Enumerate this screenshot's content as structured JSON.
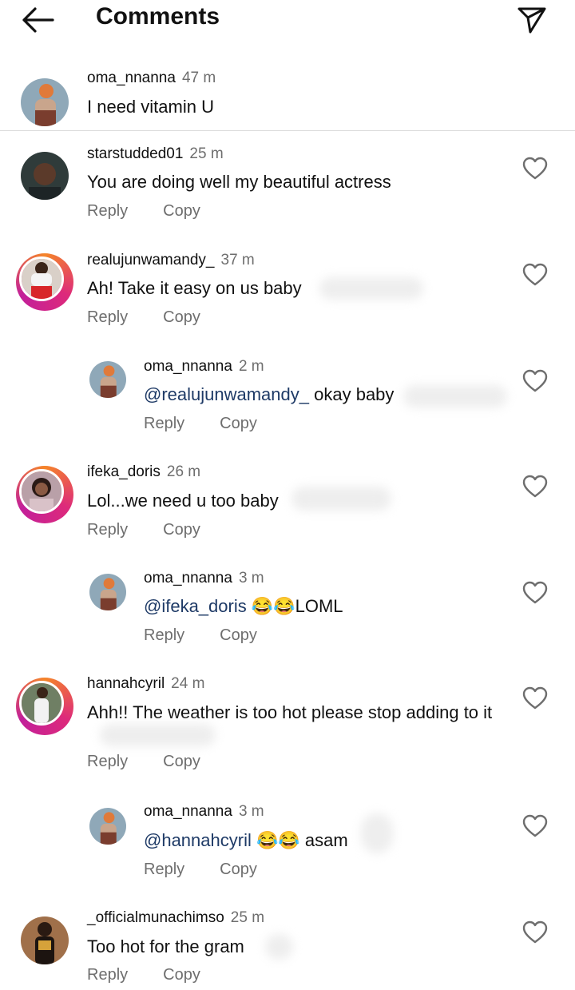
{
  "header": {
    "title": "Comments"
  },
  "caption": {
    "user": "oma_nnanna",
    "time": "47 m",
    "text": "I need vitamin U"
  },
  "comments": [
    {
      "user": "starstudded01",
      "time": "25 m",
      "text": "You are doing well my beautiful actress",
      "reply": "Reply",
      "copy": "Copy"
    },
    {
      "user": "realujunwamandy_",
      "time": "37 m",
      "text": "Ah! Take it easy on us baby",
      "reply": "Reply",
      "copy": "Copy"
    },
    {
      "user": "oma_nnanna",
      "time": "2 m",
      "mention": "@realujunwamandy_",
      "text": " okay baby",
      "reply": "Reply",
      "copy": "Copy"
    },
    {
      "user": "ifeka_doris",
      "time": "26 m",
      "text": "Lol...we need u too baby",
      "reply": "Reply",
      "copy": "Copy"
    },
    {
      "user": "oma_nnanna",
      "time": "3 m",
      "mention": "@ifeka_doris",
      "text": " 😂😂LOML",
      "reply": "Reply",
      "copy": "Copy"
    },
    {
      "user": "hannahcyril",
      "time": "24 m",
      "text": "Ahh!! The weather is too hot please stop adding to it",
      "reply": "Reply",
      "copy": "Copy"
    },
    {
      "user": "oma_nnanna",
      "time": "3 m",
      "mention": "@hannahcyril",
      "text": " 😂😂 asam",
      "reply": "Reply",
      "copy": "Copy"
    },
    {
      "user": "_officialmunachimso",
      "time": "25 m",
      "text": "Too hot for the gram",
      "reply": "Reply",
      "copy": "Copy"
    }
  ],
  "colors": {
    "accent_ring_start": "#f58529",
    "accent_ring_end": "#dd2a7b",
    "mention": "#1e3a66",
    "muted": "#6e6e6e"
  },
  "icons": [
    "back-arrow-icon",
    "send-icon",
    "heart-icon"
  ]
}
